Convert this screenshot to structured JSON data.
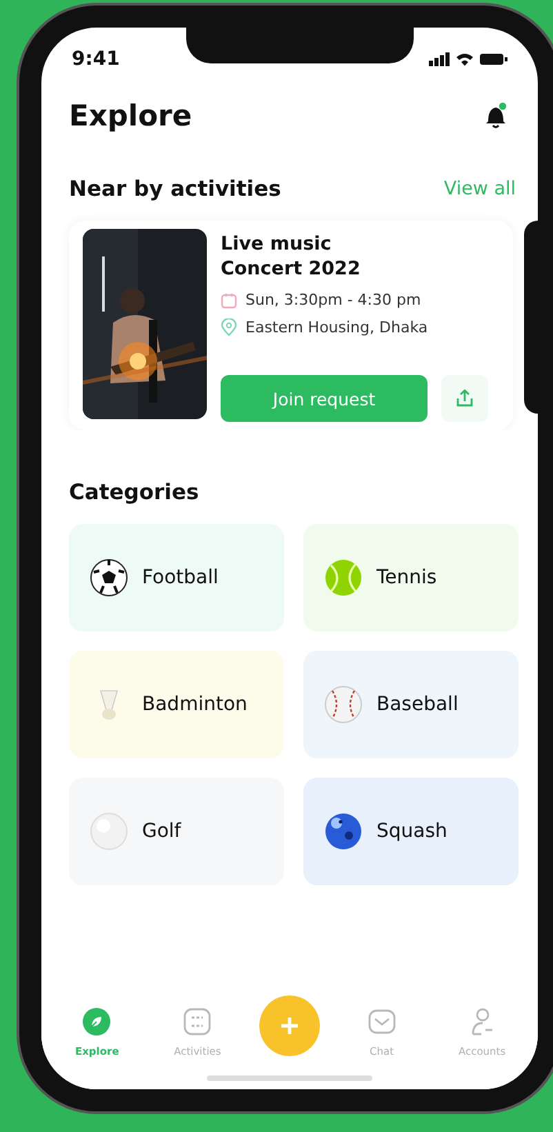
{
  "status_bar": {
    "time": "9:41"
  },
  "header": {
    "title": "Explore",
    "notifications": {
      "unread": true
    }
  },
  "nearby": {
    "title": "Near by activities",
    "link": "View all",
    "activities": [
      {
        "title": "Live music\nConcert  2022",
        "date": "Sun, 3:30pm - 4:30 pm",
        "location": "Eastern Housing, Dhaka",
        "button": "Join request"
      }
    ]
  },
  "categories": {
    "title": "Categories",
    "items": [
      {
        "label": "Football",
        "color": "#eefaf5"
      },
      {
        "label": "Tennis",
        "color": "#f0fbee"
      },
      {
        "label": "Badminton",
        "color": "#fdfbea"
      },
      {
        "label": "Baseball",
        "color": "#eef6fc"
      },
      {
        "label": "Golf",
        "color": "#f5f7f8"
      },
      {
        "label": "Squash",
        "color": "#e8f0fb"
      }
    ]
  },
  "tab_bar": [
    {
      "kind": "tab",
      "label": "Explore",
      "selected": true
    },
    {
      "kind": "tab",
      "label": "Activities",
      "selected": false
    },
    {
      "kind": "add"
    },
    {
      "kind": "tab",
      "label": "Chat",
      "selected": false
    },
    {
      "kind": "tab",
      "label": "Accounts",
      "selected": false
    }
  ]
}
